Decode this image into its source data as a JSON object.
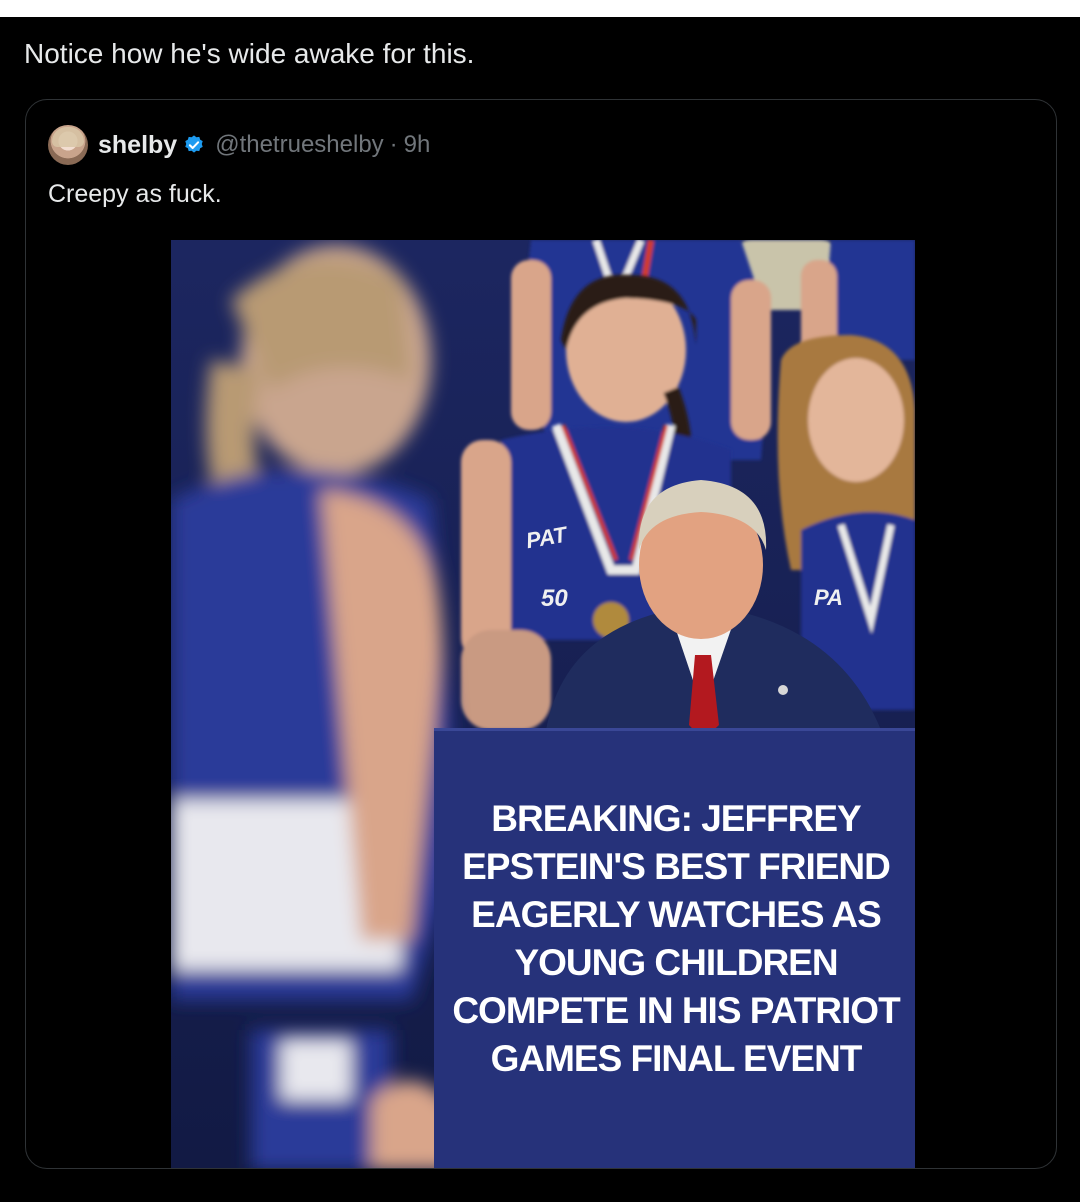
{
  "post": {
    "text": "Notice how he's wide awake for this."
  },
  "quoted_post": {
    "author_name": "shelby",
    "verified": true,
    "handle": "@thetrueshelby",
    "separator": "·",
    "time": "9h",
    "text": "Creepy as fuck.",
    "avatar_icon": "user-avatar"
  },
  "image": {
    "headline_lines": [
      "BREAKING: JEFFREY",
      "EPSTEIN'S BEST FRIEND",
      "EAGERLY WATCHES AS",
      "YOUNG CHILDREN",
      "COMPETE IN HIS PATRIOT",
      "GAMES FINAL EVENT"
    ],
    "jersey_text_1": "PAT",
    "jersey_text_2": "50",
    "jersey_text_3": "PA",
    "colors": {
      "panel": "#26327a",
      "jersey": "#22307a",
      "suit": "#1f2c5e",
      "tie": "#b3191f"
    }
  },
  "colors": {
    "background": "#000000",
    "text_primary": "#e7e9ea",
    "text_secondary": "#71767b",
    "border": "#2f3336",
    "verified": "#1d9bf0"
  }
}
